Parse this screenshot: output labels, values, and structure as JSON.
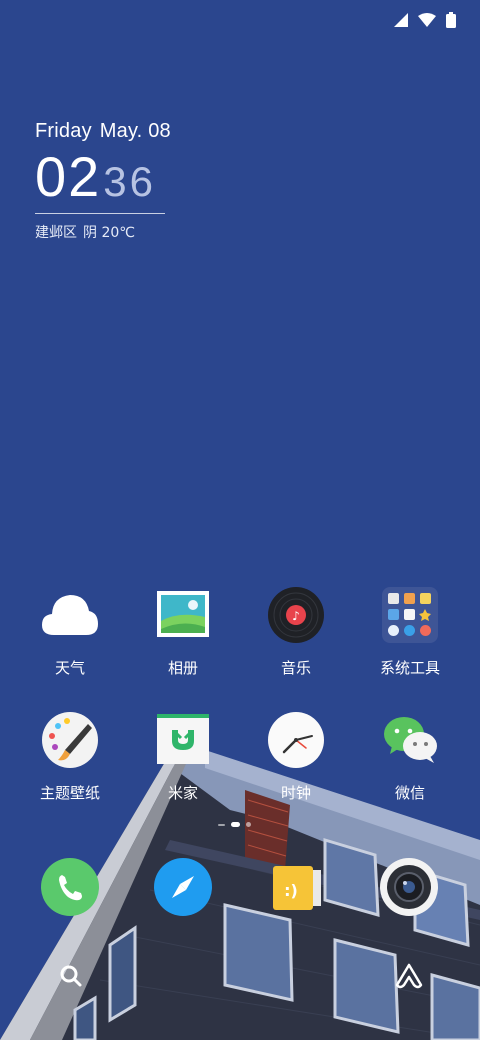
{
  "clock_widget": {
    "day": "Friday",
    "date": "May. 08",
    "hours": "02",
    "minutes": "36",
    "location": "建邺区",
    "weather": "阴 20℃"
  },
  "apps": [
    {
      "label": "天气",
      "icon": "weather-cloud-icon"
    },
    {
      "label": "相册",
      "icon": "gallery-icon"
    },
    {
      "label": "音乐",
      "icon": "music-disc-icon"
    },
    {
      "label": "系统工具",
      "icon": "system-tools-folder-icon"
    },
    {
      "label": "主题壁纸",
      "icon": "themes-palette-icon"
    },
    {
      "label": "米家",
      "icon": "mijia-icon"
    },
    {
      "label": "时钟",
      "icon": "clock-icon"
    },
    {
      "label": "微信",
      "icon": "wechat-icon"
    }
  ],
  "dock": [
    "phone-icon",
    "browser-compass-icon",
    "notes-icon",
    "camera-icon"
  ],
  "bottom_bar": [
    "search-icon",
    "assistant-icon"
  ],
  "colors": {
    "background": "#2b468e",
    "phone_green": "#5ac96c",
    "browser_blue": "#1f9cf0",
    "notes_yellow": "#f6c437"
  }
}
